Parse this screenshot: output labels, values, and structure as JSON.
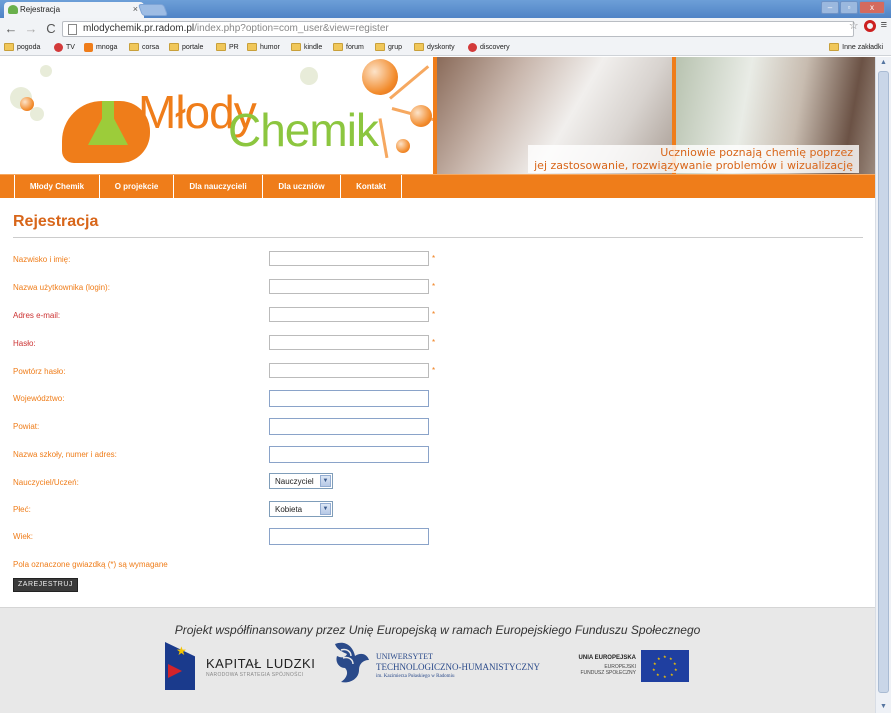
{
  "browser": {
    "tab_title": "Rejestracja",
    "tab_close": "×",
    "url_host": "mlodychemik.pr.radom.pl",
    "url_path": "/index.php?option=com_user&view=register",
    "nav_back": "←",
    "nav_forward": "→",
    "nav_reload": "C",
    "star_icon": "☆",
    "menu_icon": "≡",
    "win_minimize": "–",
    "win_restore": "▫",
    "win_close": "x",
    "bookmarks": [
      {
        "label": "pogoda",
        "icon": "folder"
      },
      {
        "label": "TV",
        "icon": "red"
      },
      {
        "label": "mnoga",
        "icon": "orange"
      },
      {
        "label": "corsa",
        "icon": "folder"
      },
      {
        "label": "portale",
        "icon": "folder"
      },
      {
        "label": "PR",
        "icon": "folder"
      },
      {
        "label": "humor",
        "icon": "folder"
      },
      {
        "label": "kindle",
        "icon": "folder"
      },
      {
        "label": "forum",
        "icon": "folder"
      },
      {
        "label": "grup",
        "icon": "folder"
      },
      {
        "label": "dyskonty",
        "icon": "folder"
      },
      {
        "label": "discovery",
        "icon": "red"
      }
    ],
    "other_bookmarks": "Inne zakładki",
    "scroll_up": "▲",
    "scroll_down": "▼"
  },
  "banner": {
    "logo_text_1": "Młody",
    "logo_text_2": "Chemik",
    "tagline_1": "Uczniowie poznają chemię poprzez",
    "tagline_2": "jej zastosowanie, rozwiązywanie problemów i wizualizację"
  },
  "menu": [
    {
      "label": "Młody Chemik"
    },
    {
      "label": "O projekcie"
    },
    {
      "label": "Dla nauczycieli"
    },
    {
      "label": "Dla uczniów"
    },
    {
      "label": "Kontakt"
    }
  ],
  "form": {
    "title": "Rejestracja",
    "required_mark": "*",
    "fields": [
      {
        "label": "Nazwisko i imię:",
        "required": true,
        "value": ""
      },
      {
        "label": "Nazwa użytkownika (login):",
        "required": true,
        "value": ""
      },
      {
        "label": "Adres e-mail:",
        "required": true,
        "value": ""
      },
      {
        "label": "Hasło:",
        "required": true,
        "value": ""
      },
      {
        "label": "Powtórz hasło:",
        "required": true,
        "value": ""
      },
      {
        "label": "Województwo:",
        "required": false,
        "value": ""
      },
      {
        "label": "Powiat:",
        "required": false,
        "value": ""
      },
      {
        "label": "Nazwa szkoły, numer i adres:",
        "required": false,
        "value": ""
      }
    ],
    "role_label": "Nauczyciel/Uczeń:",
    "role_value": "Nauczyciel",
    "gender_label": "Płeć:",
    "gender_value": "Kobieta",
    "age_label": "Wiek:",
    "age_value": "",
    "select_arrow": "▼",
    "required_note": "Pola oznaczone gwiazdką (*) są wymagane",
    "submit_label": "ZAREJESTRUJ"
  },
  "footer": {
    "text": "Projekt współfinansowany przez Unię Europejską w ramach Europejskiego Funduszu Społecznego",
    "kl_name": "KAPITAŁ LUDZKI",
    "kl_sub": "NARODOWA STRATEGIA SPÓJNOŚCI",
    "uth_1": "UNIWERSYTET",
    "uth_2": "TECHNOLOGICZNO-HUMANISTYCZNY",
    "uth_3": "im. Kazimierza Pułaskiego w Radomiu",
    "ue_1": "UNIA EUROPEJSKA",
    "ue_2": "EUROPEJSKI",
    "ue_3": "FUNDUSZ SPOŁECZNY"
  },
  "colors": {
    "brand_orange": "#ef7d1a",
    "brand_green": "#8cc63f",
    "label_red": "#cc3333"
  }
}
